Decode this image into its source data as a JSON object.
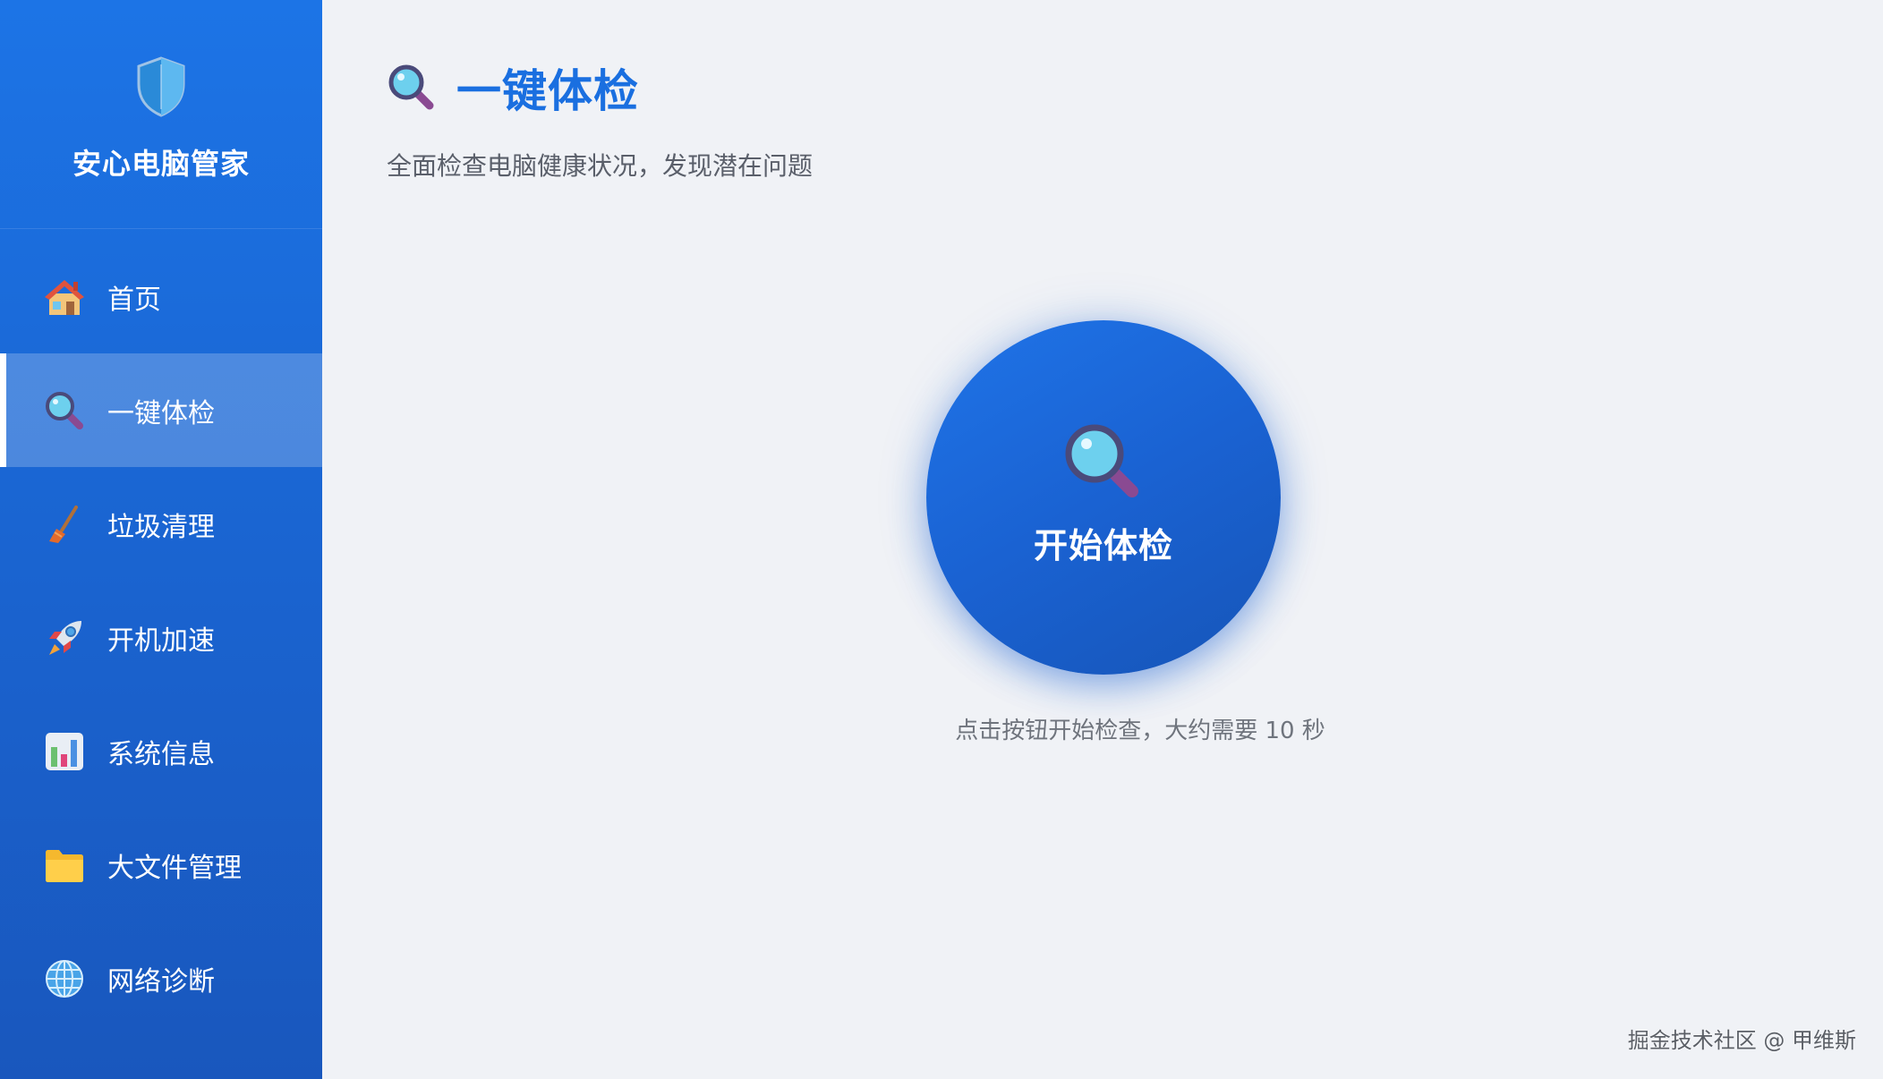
{
  "app": {
    "name": "安心电脑管家"
  },
  "sidebar": {
    "items": [
      {
        "label": "首页",
        "icon": "house-icon"
      },
      {
        "label": "一键体检",
        "icon": "magnifier-icon",
        "active": true
      },
      {
        "label": "垃圾清理",
        "icon": "broom-icon"
      },
      {
        "label": "开机加速",
        "icon": "rocket-icon"
      },
      {
        "label": "系统信息",
        "icon": "bar-chart-icon"
      },
      {
        "label": "大文件管理",
        "icon": "folder-icon"
      },
      {
        "label": "网络诊断",
        "icon": "globe-icon"
      }
    ]
  },
  "page": {
    "title": "一键体检",
    "subtitle": "全面检查电脑健康状况，发现潜在问题",
    "title_icon": "magnifier-icon"
  },
  "check": {
    "button_label": "开始体检",
    "hint": "点击按钮开始检查，大约需要 10 秒",
    "icon": "magnifier-icon"
  },
  "watermark": {
    "text": "掘金技术社区 @ 甲维斯"
  },
  "colors": {
    "sidebar_top": "#1c74e6",
    "sidebar_bottom": "#1957bd",
    "accent": "#1a6fe0",
    "background": "#f0f2f6"
  }
}
